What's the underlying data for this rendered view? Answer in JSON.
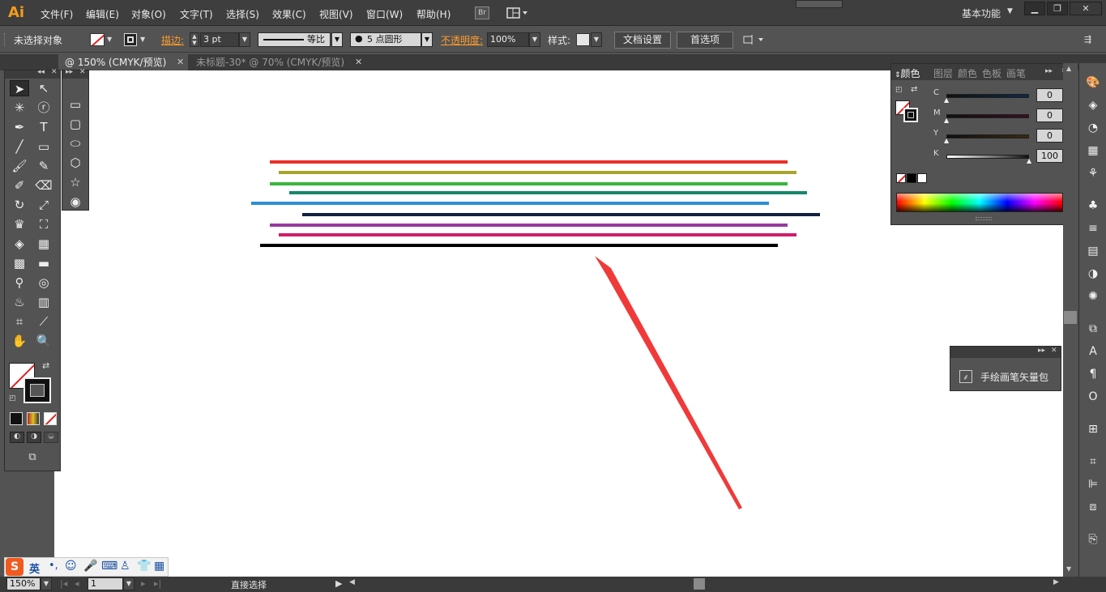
{
  "app": {
    "logo": "Ai"
  },
  "menu": [
    "文件(F)",
    "编辑(E)",
    "对象(O)",
    "文字(T)",
    "选择(S)",
    "效果(C)",
    "视图(V)",
    "窗口(W)",
    "帮助(H)"
  ],
  "menubar_extras": {
    "bridge": "Br",
    "workspace": "基本功能"
  },
  "window_buttons": {
    "minimize": "▁",
    "restore": "❐",
    "close": "✕"
  },
  "control": {
    "selection": "未选择对象",
    "stroke_label": "描边:",
    "stroke_weight": "3 pt",
    "profile": "等比",
    "brush": "5 点圆形",
    "opacity_label": "不透明度:",
    "opacity": "100%",
    "style_label": "样式:",
    "doc_setup": "文档设置",
    "preferences": "首选项"
  },
  "tabs": [
    {
      "label": "@ 150% (CMYK/预览)",
      "active": true
    },
    {
      "label": "未标题-30* @ 70% (CMYK/预览)",
      "active": false
    }
  ],
  "color_panel": {
    "tabs": [
      "颜色",
      "图层",
      "颜色",
      "色板",
      "画笔"
    ],
    "sliders": [
      {
        "label": "C",
        "value": "0"
      },
      {
        "label": "M",
        "value": "0"
      },
      {
        "label": "Y",
        "value": "0"
      },
      {
        "label": "K",
        "value": "100"
      }
    ],
    "percent": "%"
  },
  "brush_panel": {
    "item": "手绘画笔矢量包"
  },
  "status": {
    "zoom": "150%",
    "page": "1",
    "tool": "直接选择"
  },
  "ime": {
    "lang": "英"
  },
  "colors": {
    "accent_orange": "#f59b1b",
    "arrow": "#f03a3a",
    "lines": [
      "#e8302a",
      "#a8a52a",
      "#3cb43c",
      "#17866a",
      "#2e8fd4",
      "#142040",
      "#973a9e",
      "#d01c6a",
      "#000000"
    ]
  },
  "artwork": {
    "description_free": true
  }
}
